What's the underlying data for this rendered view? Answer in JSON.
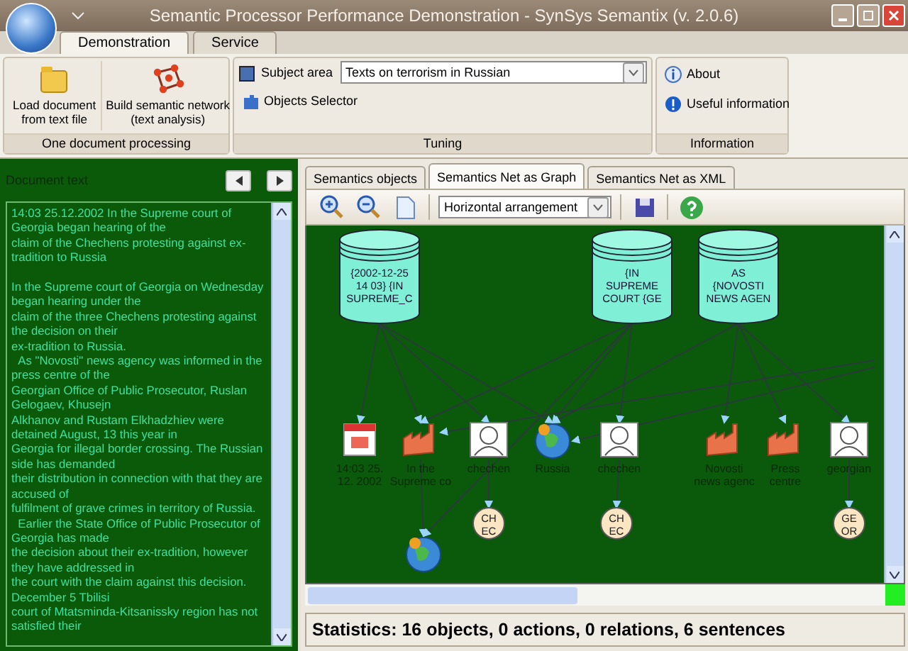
{
  "window": {
    "title": "Semantic Processor Performance Demonstration - SynSys Semantix (v. 2.0.6)"
  },
  "ribbon": {
    "tabs": [
      {
        "label": "Demonstration",
        "selected": true
      },
      {
        "label": "Service",
        "selected": false
      }
    ],
    "groups": [
      {
        "caption": "One document processing",
        "items": [
          {
            "kind": "large",
            "label": "Load document\nfrom text file"
          },
          {
            "kind": "large",
            "label": "Build semantic network\n(text analysis)"
          }
        ]
      },
      {
        "caption": "Tuning",
        "items": [
          {
            "kind": "combo",
            "label": "Subject area",
            "value": "Texts on terrorism in Russian"
          },
          {
            "kind": "small",
            "label": "Objects Selector"
          }
        ]
      },
      {
        "caption": "Information",
        "items": [
          {
            "kind": "small",
            "label": "About"
          },
          {
            "kind": "small",
            "label": "Useful information"
          }
        ]
      }
    ]
  },
  "document": {
    "title": "Document text",
    "paragraphs": [
      [
        "14:03 25.12.2002 In the Supreme court of Georgia began hearing of the",
        "claim of the Chechens protesting against ex-tradition to Russia"
      ],
      [
        "In the Supreme court of Georgia on Wednesday began hearing under the",
        "claim of the three Chechens protesting against the decision on their",
        "ex-tradition to Russia.",
        "  As \"Novosti\" news agency was informed in the press centre of the",
        "Georgian Office of Public Prosecutor, Ruslan Gelogaev, Khusejn",
        "Alkhanov and Rustam Elkhadzhiev were detained August, 13 this year in",
        "Georgia for illegal border crossing. The Russian side has demanded",
        "their distribution in connection with that they are accused of",
        "fulfilment of grave crimes in territory of Russia.",
        "  Earlier the State Office of Public Prosecutor of Georgia has made",
        "the decision about their ex-tradition, however they have addressed in",
        "the court with the claim against this decision. December 5 Tbilisi",
        "court of Mtatsminda-Kitsanissky region has not satisfied their"
      ]
    ]
  },
  "view_tabs": [
    {
      "label": "Semantics objects",
      "selected": false
    },
    {
      "label": "Semantics Net as Graph",
      "selected": true
    },
    {
      "label": "Semantics Net as XML",
      "selected": false
    }
  ],
  "toolbar": {
    "arrangement": "Horizontal arrangement"
  },
  "graph": {
    "nodes": [
      {
        "kind": "cylinder",
        "label": [
          "{2002-12-25",
          "14 03} {IN",
          "SUPREME_C"
        ]
      },
      {
        "kind": "cylinder",
        "label": [
          "{IN",
          "SUPREME",
          "COURT {GE"
        ]
      },
      {
        "kind": "cylinder",
        "label": [
          "AS",
          "{NOVOSTI",
          "NEWS AGEN"
        ]
      },
      {
        "kind": "calendar",
        "label": [
          "14:03 25.",
          "12. 2002"
        ]
      },
      {
        "kind": "factory",
        "label": [
          "In the",
          "Supreme co"
        ]
      },
      {
        "kind": "person",
        "label": [
          "chechen"
        ]
      },
      {
        "kind": "globe",
        "label": [
          "Russia"
        ]
      },
      {
        "kind": "person",
        "label": [
          "chechen"
        ]
      },
      {
        "kind": "factory",
        "label": [
          "Novosti",
          "news agenc"
        ]
      },
      {
        "kind": "factory",
        "label": [
          "Press",
          "centre"
        ]
      },
      {
        "kind": "person",
        "label": [
          "georgian"
        ]
      },
      {
        "kind": "circle",
        "label": [
          "CH",
          "EC"
        ]
      },
      {
        "kind": "circle",
        "label": [
          "CH",
          "EC"
        ]
      },
      {
        "kind": "circle",
        "label": [
          "GE",
          "OR"
        ]
      },
      {
        "kind": "globe"
      }
    ]
  },
  "status_bar": "Statistics: 16 objects, 0 actions, 0 relations, 6 sentences"
}
